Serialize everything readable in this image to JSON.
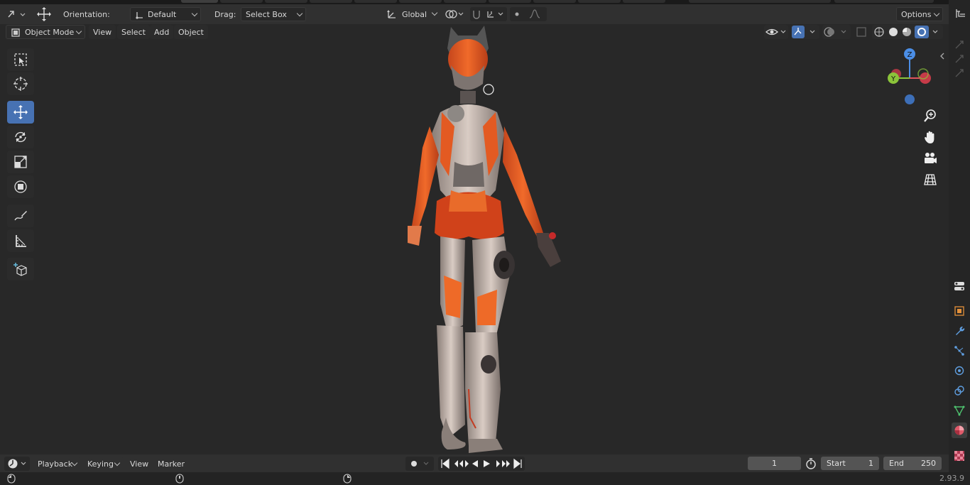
{
  "header": {
    "orientation_label": "Orientation:",
    "orientation_value": "Default",
    "drag_label": "Drag:",
    "drag_value": "Select Box",
    "transform_orientation": "Global",
    "options_label": "Options"
  },
  "viewport_header": {
    "mode": "Object Mode",
    "menus": [
      "View",
      "Select",
      "Add",
      "Object"
    ]
  },
  "gizmo": {
    "z": "Z",
    "y": "Y"
  },
  "timeline": {
    "menus": [
      "Playback",
      "Keying",
      "View",
      "Marker"
    ],
    "current_frame": "1",
    "start_label": "Start",
    "start_value": "1",
    "end_label": "End",
    "end_value": "250"
  },
  "status": {
    "version": "2.93.9"
  },
  "colors": {
    "accent": "#4772b3",
    "viewport": "#282828",
    "header": "#303030"
  }
}
